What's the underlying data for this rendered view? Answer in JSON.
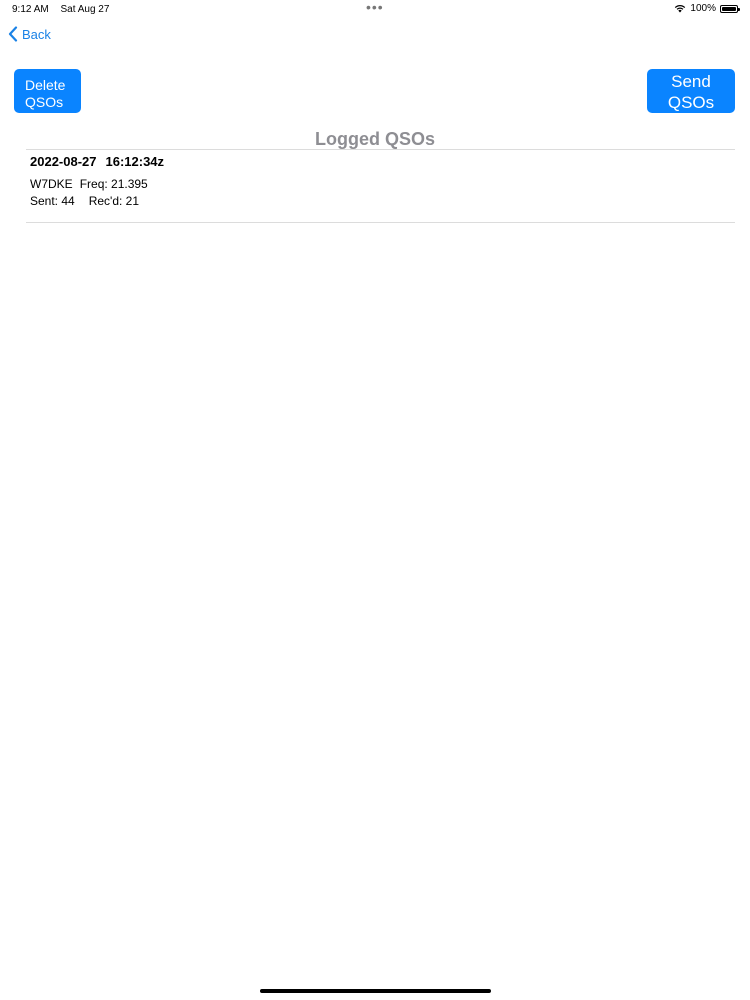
{
  "status_bar": {
    "time": "9:12 AM",
    "date": "Sat Aug 27",
    "dots": "•••",
    "battery_text": "100%",
    "battery_level": 1.0
  },
  "nav": {
    "back_label": "Back"
  },
  "toolbar": {
    "delete_label": "Delete\nQSOs",
    "send_label": "Send\nQSOs"
  },
  "page": {
    "title": "Logged QSOs"
  },
  "qsos": [
    {
      "date": "2022-08-27",
      "time": "16:12:34z",
      "callsign": "W7DKE",
      "freq": "Freq: 21.395",
      "sent": "Sent: 44",
      "recd": "Rec'd: 21"
    }
  ],
  "colors": {
    "accent": "#0a84ff",
    "link": "#1a82e6",
    "title_gray": "#8e8e93"
  }
}
